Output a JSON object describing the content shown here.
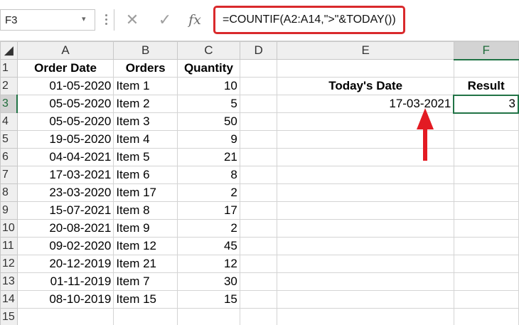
{
  "name_box": {
    "value": "F3",
    "arrow": "▾"
  },
  "formula_bar": {
    "cancel_glyph": "✕",
    "enter_glyph": "✓",
    "fx_label": "fx",
    "formula": "=COUNTIF(A2:A14,\">\"&TODAY())"
  },
  "columns": [
    "A",
    "B",
    "C",
    "D",
    "E",
    "F"
  ],
  "rows": [
    {
      "num": "1",
      "a": "Order Date",
      "b": "Orders",
      "c": "Quantity",
      "d": "",
      "e": "",
      "f": ""
    },
    {
      "num": "2",
      "a": "01-05-2020",
      "b": "Item 1",
      "c": "10",
      "d": "",
      "e": "Today's Date",
      "f": "Result"
    },
    {
      "num": "3",
      "a": "05-05-2020",
      "b": "Item 2",
      "c": "5",
      "d": "",
      "e": "17-03-2021",
      "f": "3"
    },
    {
      "num": "4",
      "a": "05-05-2020",
      "b": "Item 3",
      "c": "50",
      "d": "",
      "e": "",
      "f": ""
    },
    {
      "num": "5",
      "a": "19-05-2020",
      "b": "Item 4",
      "c": "9",
      "d": "",
      "e": "",
      "f": ""
    },
    {
      "num": "6",
      "a": "04-04-2021",
      "b": "Item 5",
      "c": "21",
      "d": "",
      "e": "",
      "f": ""
    },
    {
      "num": "7",
      "a": "17-03-2021",
      "b": "Item 6",
      "c": "8",
      "d": "",
      "e": "",
      "f": ""
    },
    {
      "num": "8",
      "a": "23-03-2020",
      "b": "Item 17",
      "c": "2",
      "d": "",
      "e": "",
      "f": ""
    },
    {
      "num": "9",
      "a": "15-07-2021",
      "b": "Item 8",
      "c": "17",
      "d": "",
      "e": "",
      "f": ""
    },
    {
      "num": "10",
      "a": "20-08-2021",
      "b": "Item 9",
      "c": "2",
      "d": "",
      "e": "",
      "f": ""
    },
    {
      "num": "11",
      "a": "09-02-2020",
      "b": "Item 12",
      "c": "45",
      "d": "",
      "e": "",
      "f": ""
    },
    {
      "num": "12",
      "a": "20-12-2019",
      "b": "Item 21",
      "c": "12",
      "d": "",
      "e": "",
      "f": ""
    },
    {
      "num": "13",
      "a": "01-11-2019",
      "b": "Item 7",
      "c": "30",
      "d": "",
      "e": "",
      "f": ""
    },
    {
      "num": "14",
      "a": "08-10-2019",
      "b": "Item 15",
      "c": "15",
      "d": "",
      "e": "",
      "f": ""
    },
    {
      "num": "15",
      "a": "",
      "b": "",
      "c": "",
      "d": "",
      "e": "",
      "f": ""
    }
  ],
  "colors": {
    "accent_green": "#217346",
    "highlight_red": "#d9292c",
    "arrow_red": "#e31b23"
  },
  "icons": {
    "cancel": "close-icon",
    "enter": "check-icon",
    "function": "fx-icon",
    "annotation": "up-arrow-icon"
  }
}
